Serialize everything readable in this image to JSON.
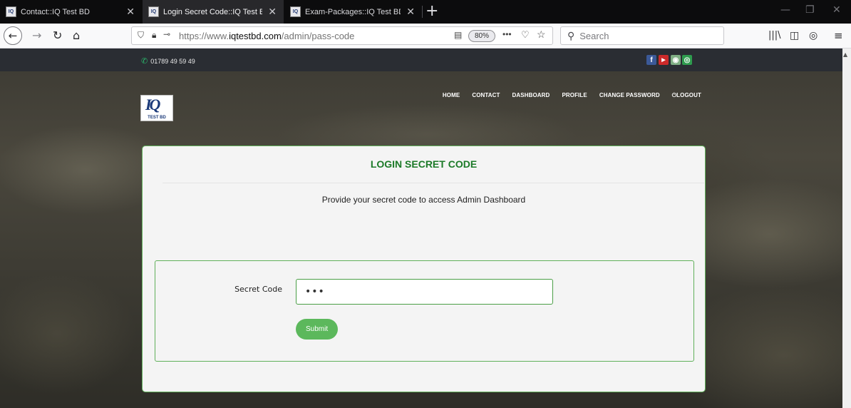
{
  "browser": {
    "tabs": [
      {
        "title": "Contact::IQ Test BD",
        "active": false
      },
      {
        "title": "Login Secret Code::IQ Test BD",
        "active": true
      },
      {
        "title": "Exam-Packages::IQ Test BD",
        "active": false
      }
    ],
    "url_scheme": "https://www.",
    "url_domain": "iqtestbd.com",
    "url_path": "/admin/pass-code",
    "zoom": "80%",
    "search_placeholder": "Search"
  },
  "site": {
    "phone": "01789 49 59 49",
    "logo_text": "TEST BD",
    "nav": [
      "HOME",
      "CONTACT",
      "DASHBOARD",
      "PROFILE",
      "CHANGE PASSWORD",
      "LOGOUT"
    ],
    "social": [
      {
        "name": "facebook-icon",
        "glyph": "f",
        "color": "#3b5998"
      },
      {
        "name": "youtube-icon",
        "glyph": "▶",
        "color": "#cc2a2a"
      },
      {
        "name": "app-icon",
        "glyph": "◉",
        "color": "#7fae84"
      },
      {
        "name": "web-icon",
        "glyph": "◎",
        "color": "#2e9b4e"
      }
    ]
  },
  "card": {
    "title": "LOGIN SECRET CODE",
    "subtitle": "Provide your secret code to access Admin Dashboard",
    "field_label": "Secret Code",
    "field_value": "•••",
    "submit_label": "Submit"
  },
  "colors": {
    "accent_green": "#5cb85c",
    "title_green": "#1c7a28",
    "border_green": "#60b05a"
  }
}
